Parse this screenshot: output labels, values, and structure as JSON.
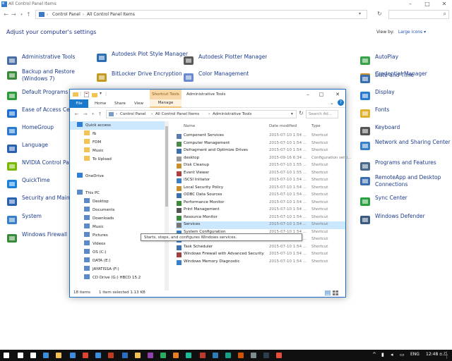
{
  "control_panel": {
    "title": "All Control Panel Items",
    "breadcrumb": [
      "Control Panel",
      "All Control Panel Items"
    ],
    "heading": "Adjust your computer's settings",
    "view_by_label": "View by:",
    "view_by_value": "Large icons",
    "items": [
      {
        "label": "Administrative Tools",
        "icon": "admin-tools-icon",
        "color": "#4a6fa5"
      },
      {
        "label": "Autodesk Plot Style Manager",
        "icon": "autodesk-plot-style-icon",
        "color": "#2e6fb3"
      },
      {
        "label": "Autodesk Plotter Manager",
        "icon": "autodesk-plotter-icon",
        "color": "#5a5a5a"
      },
      {
        "label": "AutoPlay",
        "icon": "autoplay-icon",
        "color": "#3aa34a"
      },
      {
        "label": "Backup and Restore (Windows 7)",
        "icon": "backup-icon",
        "color": "#3a8a3a"
      },
      {
        "label": "BitLocker Drive Encryption",
        "icon": "bitlocker-icon",
        "color": "#c49a20"
      },
      {
        "label": "Color Management",
        "icon": "color-management-icon",
        "color": "#6a8ad0"
      },
      {
        "label": "Credential Manager",
        "icon": "credential-manager-icon",
        "color": "#c8902a"
      },
      {
        "label": "Date and Time",
        "icon": "date-time-icon",
        "color": "#3a6fb0"
      },
      {
        "label": "Default Programs",
        "icon": "default-programs-icon",
        "color": "#2f9a3a"
      },
      {
        "label": "Display",
        "icon": "display-icon",
        "color": "#2a7ad0"
      },
      {
        "label": "Ease of Access Center",
        "icon": "ease-of-access-icon",
        "color": "#1f6fd0"
      },
      {
        "label": "Fonts",
        "icon": "fonts-icon",
        "color": "#e0b030"
      },
      {
        "label": "HomeGroup",
        "icon": "homegroup-icon",
        "color": "#2a7ad0"
      },
      {
        "label": "Keyboard",
        "icon": "keyboard-icon",
        "color": "#555555"
      },
      {
        "label": "Language",
        "icon": "language-icon",
        "color": "#2a60b0"
      },
      {
        "label": "Network and Sharing Center",
        "icon": "network-icon",
        "color": "#3a80c8"
      },
      {
        "label": "NVIDIA Control Panel",
        "icon": "nvidia-icon",
        "color": "#76b900"
      },
      {
        "label": "Programs and Features",
        "icon": "programs-features-icon",
        "color": "#4a6a8a"
      },
      {
        "label": "QuickTime",
        "icon": "quicktime-icon",
        "color": "#1a80e0"
      },
      {
        "label": "RemoteApp and Desktop Connections",
        "icon": "remoteapp-icon",
        "color": "#3a70b0"
      },
      {
        "label": "Security and Maintenance",
        "icon": "security-flag-icon",
        "color": "#2a60b0"
      },
      {
        "label": "Sync Center",
        "icon": "sync-center-icon",
        "color": "#2aa040"
      },
      {
        "label": "System",
        "icon": "system-icon",
        "color": "#3a80c8"
      },
      {
        "label": "Windows Defender",
        "icon": "windows-defender-icon",
        "color": "#3a5a80"
      },
      {
        "label": "Windows Firewall",
        "icon": "windows-firewall-icon",
        "color": "#3a8a3a"
      }
    ]
  },
  "explorer": {
    "title": "Administrative Tools",
    "contextual_tab": "Shortcut Tools",
    "ribbon_tabs": [
      "File",
      "Home",
      "Share",
      "View"
    ],
    "manage_tab": "Manage",
    "breadcrumb": [
      "Control Panel",
      "All Control Panel Items",
      "Administrative Tools"
    ],
    "search_placeholder": "Search Ad...",
    "columns": [
      "Name",
      "Date modified",
      "Type"
    ],
    "nav": [
      {
        "label": "Quick access",
        "level": 0,
        "icon": "quick-access-star-icon",
        "selected": true
      },
      {
        "label": "fb",
        "level": 1,
        "icon": "folder-icon"
      },
      {
        "label": "FDM",
        "level": 1,
        "icon": "folder-icon"
      },
      {
        "label": "Music",
        "level": 1,
        "icon": "folder-icon"
      },
      {
        "label": "To Upload",
        "level": 1,
        "icon": "folder-icon"
      },
      {
        "label": "",
        "level": 1,
        "icon": ""
      },
      {
        "label": "OneDrive",
        "level": 0,
        "icon": "onedrive-icon"
      },
      {
        "label": "",
        "level": 0,
        "icon": ""
      },
      {
        "label": "This PC",
        "level": 0,
        "icon": "this-pc-icon"
      },
      {
        "label": "Desktop",
        "level": 1,
        "icon": "desktop-folder-icon"
      },
      {
        "label": "Documents",
        "level": 1,
        "icon": "documents-folder-icon"
      },
      {
        "label": "Downloads",
        "level": 1,
        "icon": "downloads-folder-icon"
      },
      {
        "label": "Music",
        "level": 1,
        "icon": "music-folder-icon"
      },
      {
        "label": "Pictures",
        "level": 1,
        "icon": "pictures-folder-icon"
      },
      {
        "label": "Videos",
        "level": 1,
        "icon": "videos-folder-icon"
      },
      {
        "label": "OS (C:)",
        "level": 1,
        "icon": "drive-icon"
      },
      {
        "label": "DATA (E:)",
        "level": 1,
        "icon": "drive-icon"
      },
      {
        "label": "JAYATISSA (F:)",
        "level": 1,
        "icon": "drive-icon"
      },
      {
        "label": "CD Drive (G:) HBCD 15.2",
        "level": 1,
        "icon": "cd-drive-icon"
      },
      {
        "label": "",
        "level": 1,
        "icon": ""
      },
      {
        "label": "JAYATISSA (F:)",
        "level": 0,
        "icon": "drive-icon"
      }
    ],
    "files": [
      {
        "name": "Component Services",
        "date": "2015-07-10 1:54 ...",
        "type": "Shortcut",
        "icon": "component-services-icon"
      },
      {
        "name": "Computer Management",
        "date": "2015-07-10 1:54 ...",
        "type": "Shortcut",
        "icon": "computer-management-icon"
      },
      {
        "name": "Defragment and Optimize Drives",
        "date": "2015-07-10 1:54 ...",
        "type": "Shortcut",
        "icon": "defragment-icon"
      },
      {
        "name": "desktop",
        "date": "2015-09-16 6:34 ...",
        "type": "Configuration setti...",
        "icon": "config-file-icon"
      },
      {
        "name": "Disk Cleanup",
        "date": "2015-07-10 1:55 ...",
        "type": "Shortcut",
        "icon": "disk-cleanup-icon"
      },
      {
        "name": "Event Viewer",
        "date": "2015-07-10 1:55 ...",
        "type": "Shortcut",
        "icon": "event-viewer-icon"
      },
      {
        "name": "iSCSI Initiator",
        "date": "2015-07-10 1:54 ...",
        "type": "Shortcut",
        "icon": "iscsi-icon"
      },
      {
        "name": "Local Security Policy",
        "date": "2015-07-10 1:54 ...",
        "type": "Shortcut",
        "icon": "security-policy-icon"
      },
      {
        "name": "ODBC Data Sources",
        "date": "2015-07-10 1:54 ...",
        "type": "Shortcut",
        "icon": "odbc-icon"
      },
      {
        "name": "Performance Monitor",
        "date": "2015-07-10 1:54 ...",
        "type": "Shortcut",
        "icon": "performance-monitor-icon"
      },
      {
        "name": "Print Management",
        "date": "2015-07-10 1:54 ...",
        "type": "Shortcut",
        "icon": "print-management-icon"
      },
      {
        "name": "Resource Monitor",
        "date": "2015-07-10 1:54 ...",
        "type": "Shortcut",
        "icon": "resource-monitor-icon"
      },
      {
        "name": "Services",
        "date": "2015-07-10 1:54 ...",
        "type": "Shortcut",
        "icon": "services-icon",
        "selected": true
      },
      {
        "name": "System Configuration",
        "date": "2015-07-10 1:54 ...",
        "type": "Shortcut",
        "icon": "system-configuration-icon"
      },
      {
        "name": "System Information",
        "date": "2015-07-10 1:54 ...",
        "type": "Shortcut",
        "icon": "system-information-icon"
      },
      {
        "name": "Task Scheduler",
        "date": "2015-07-10 1:54 ...",
        "type": "Shortcut",
        "icon": "task-scheduler-icon"
      },
      {
        "name": "Windows Firewall with Advanced Security",
        "date": "2015-07-10 1:54 ...",
        "type": "Shortcut",
        "icon": "firewall-advanced-icon"
      },
      {
        "name": "Windows Memory Diagnostic",
        "date": "2015-07-10 1:54 ...",
        "type": "Shortcut",
        "icon": "memory-diagnostic-icon"
      }
    ],
    "tooltip": "Starts, stops, and configures Windows services.",
    "status_count": "18 items",
    "status_selected": "1 item selected  1.13 KB"
  },
  "taskbar": {
    "language": "ENG",
    "time": "12:48 ප.ව.",
    "icons": [
      "start-windows-icon",
      "search-icon",
      "task-view-icon",
      "edge-icon",
      "file-explorer-icon",
      "store-icon",
      "chrome-icon",
      "mail-icon",
      "app-icon",
      "app-icon",
      "quicktime-taskbar-icon",
      "app-icon",
      "app-icon",
      "app-icon",
      "app-icon",
      "app-icon",
      "app-icon",
      "app-icon",
      "app-icon",
      "app-icon",
      "app-icon",
      "app-icon"
    ],
    "icon_colors": [
      "#ffffff",
      "#ffffff",
      "#ffffff",
      "#3b8ede",
      "#f2c14e",
      "#3b8ede",
      "#e34133",
      "#3b8ede",
      "#c23b22",
      "#2a6fc4",
      "#f2c14e",
      "#8e44ad",
      "#27ae60",
      "#e67e22",
      "#1abc9c",
      "#c0392b",
      "#2980b9",
      "#16a085",
      "#d35400",
      "#7f8c8d",
      "#2c3e50",
      "#e74c3c"
    ]
  }
}
